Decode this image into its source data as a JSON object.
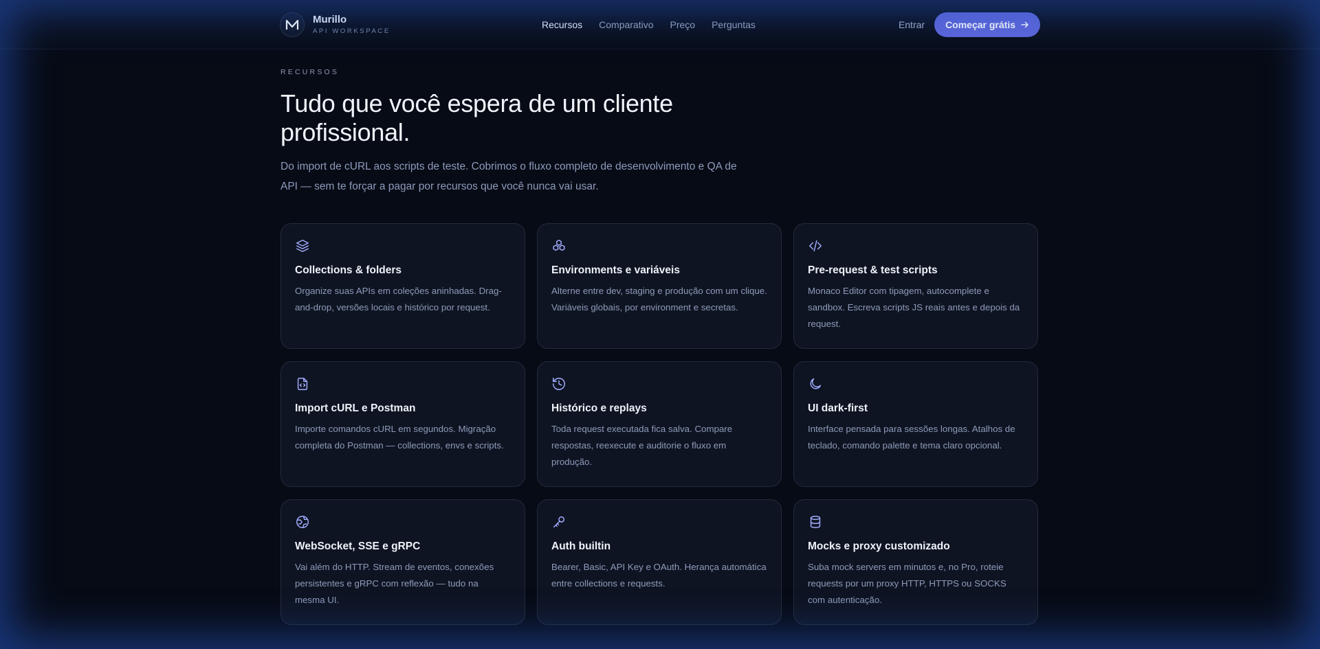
{
  "brand": {
    "name": "Murillo",
    "subtitle": "API WORKSPACE",
    "logo_icon": "m-logo-icon"
  },
  "nav": {
    "items": [
      {
        "label": "Recursos",
        "active": true
      },
      {
        "label": "Comparativo",
        "active": false
      },
      {
        "label": "Preço",
        "active": false
      },
      {
        "label": "Perguntas",
        "active": false
      }
    ],
    "login_label": "Entrar",
    "cta_label": "Começar grátis",
    "cta_icon": "arrow-right-icon"
  },
  "hero": {
    "eyebrow": "RECURSOS",
    "title": "Tudo que você espera de um cliente profissional.",
    "lead": "Do import de cURL aos scripts de teste. Cobrimos o fluxo completo de desenvolvimento e QA de API — sem te forçar a pagar por recursos que você nunca vai usar."
  },
  "features": [
    {
      "icon": "layers-icon",
      "title": "Collections & folders",
      "desc": "Organize suas APIs em coleções aninhadas. Drag-and-drop, versões locais e histórico por request."
    },
    {
      "icon": "boxes-icon",
      "title": "Environments e variáveis",
      "desc": "Alterne entre dev, staging e produção com um clique. Variáveis globais, por environment e secretas."
    },
    {
      "icon": "code-icon",
      "title": "Pre-request & test scripts",
      "desc": "Monaco Editor com tipagem, autocomplete e sandbox. Escreva scripts JS reais antes e depois da request."
    },
    {
      "icon": "file-code-icon",
      "title": "Import cURL e Postman",
      "desc": "Importe comandos cURL em segundos. Migração completa do Postman — collections, envs e scripts."
    },
    {
      "icon": "history-icon",
      "title": "Histórico e replays",
      "desc": "Toda request executada fica salva. Compare respostas, reexecute e auditorie o fluxo em produção."
    },
    {
      "icon": "moon-icon",
      "title": "UI dark-first",
      "desc": "Interface pensada para sessões longas. Atalhos de teclado, comando palette e tema claro opcional."
    },
    {
      "icon": "globe-icon",
      "title": "WebSocket, SSE e gRPC",
      "desc": "Vai além do HTTP. Stream de eventos, conexões persistentes e gRPC com reflexão — tudo na mesma UI."
    },
    {
      "icon": "key-icon",
      "title": "Auth builtin",
      "desc": "Bearer, Basic, API Key e OAuth. Herança automática entre collections e requests."
    },
    {
      "icon": "database-icon",
      "title": "Mocks e proxy customizado",
      "desc": "Suba mock servers em minutos e, no Pro, roteie requests por um proxy HTTP, HTTPS ou SOCKS com autenticação."
    }
  ],
  "colors": {
    "background": "#070b16",
    "accent": "#5d66d9",
    "icon": "#a3adff",
    "card": "#0e1422"
  }
}
